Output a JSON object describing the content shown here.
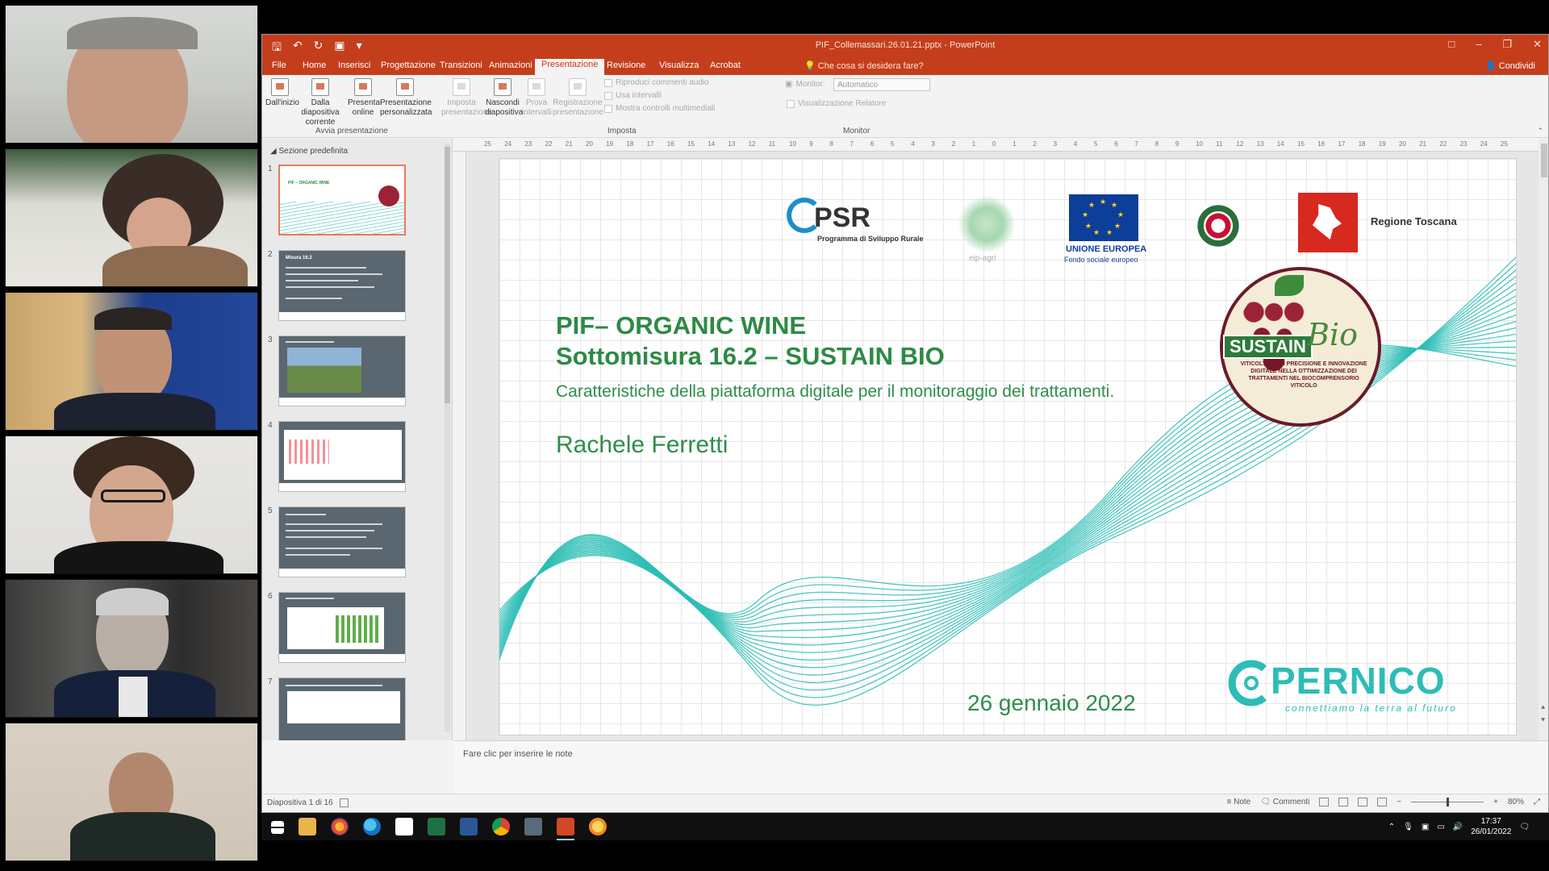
{
  "window": {
    "title": "PIF_Collemassari.26.01.21.pptx - PowerPoint",
    "tabs": [
      "File",
      "Home",
      "Inserisci",
      "Progettazione",
      "Transizioni",
      "Animazioni",
      "Presentazione",
      "Revisione",
      "Visualizza",
      "Acrobat"
    ],
    "active_tab": "Presentazione",
    "tell_me": "Che cosa si desidera fare?",
    "share": "Condividi"
  },
  "ribbon": {
    "avvia": {
      "group_label": "Avvia presentazione",
      "buttons": [
        "Dall'inizio",
        "Dalla diapositiva corrente",
        "Presenta online",
        "Presentazione personalizzata"
      ]
    },
    "imposta": {
      "group_label": "Imposta",
      "buttons": [
        "Imposta presentazione",
        "Nascondi diapositiva",
        "Prova intervalli",
        "Registrazione presentazione"
      ],
      "checks": [
        "Riproduci commenti audio",
        "Usa intervalli",
        "Mostra controlli multimediali"
      ]
    },
    "monitor": {
      "group_label": "Monitor",
      "monitor_label": "Monitor:",
      "monitor_value": "Automatico",
      "presenter_view": "Visualizzazione Relatore"
    }
  },
  "thumbnails": {
    "section": "Sezione predefinita",
    "numbers": [
      "1",
      "2",
      "3",
      "4",
      "5",
      "6",
      "7"
    ],
    "slide2_title": "Misura 16.2",
    "slide1_title": "PIF – ORGANIC WINE"
  },
  "slide": {
    "title_line1": "PIF– ORGANIC WINE",
    "title_line2": "Sottomisura 16.2 – SUSTAIN BIO",
    "subtitle": "Caratteristiche della piattaforma digitale per il monitoraggio dei trattamenti.",
    "author": "Rachele Ferretti",
    "date": "26 gennaio 2022",
    "logos": {
      "psr": "PSR",
      "psr_caption": "Programma di Sviluppo Rurale",
      "eip": "eip-agri",
      "eu_line1": "UNIONE EUROPEA",
      "eu_line2": "Fondo sociale europeo",
      "toscana": "Regione Toscana",
      "sustain": "SUSTAIN",
      "bio": "Bio",
      "sustain_arc": "VITICOLTURA DI PRECISIONE E INNOVAZIONE DIGITALE NELLA OTTIMIZZAZIONE DEI TRATTAMENTI NEL BIOCOMPRENSORIO VITICOLO",
      "copernico": "PERNICO",
      "copernico_tag": "connettiamo la terra al futuro"
    },
    "ruler_numbers": [
      "25",
      "24",
      "23",
      "22",
      "21",
      "20",
      "19",
      "18",
      "17",
      "16",
      "15",
      "14",
      "13",
      "12",
      "11",
      "10",
      "9",
      "8",
      "7",
      "6",
      "5",
      "4",
      "3",
      "2",
      "1",
      "0",
      "1",
      "2",
      "3",
      "4",
      "5",
      "6",
      "7",
      "8",
      "9",
      "10",
      "11",
      "12",
      "13",
      "14",
      "15",
      "16",
      "17",
      "18",
      "19",
      "20",
      "21",
      "22",
      "23",
      "24",
      "25"
    ]
  },
  "notes": {
    "placeholder": "Fare clic per inserire le note"
  },
  "status": {
    "slide_of": "Diapositiva 1 di 16",
    "notes": "Note",
    "comments": "Commenti",
    "zoom": "80%"
  },
  "taskbar": {
    "time": "17:37",
    "date": "26/01/2022"
  },
  "colors": {
    "accent": "#c43e1c",
    "slide_green": "#2e8e4a",
    "wave": "#2cbdb6"
  }
}
